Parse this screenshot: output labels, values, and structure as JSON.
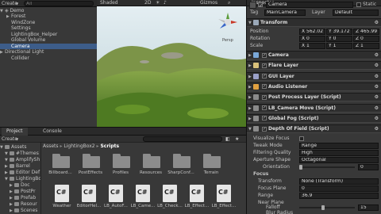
{
  "hierarchy": {
    "create_label": "Create",
    "search_placeholder": "All",
    "scene_name": "Demo",
    "items": [
      {
        "label": "Forest",
        "indent": 1,
        "selected": false,
        "expander": true
      },
      {
        "label": "WindZone",
        "indent": 1,
        "selected": false,
        "expander": false
      },
      {
        "label": "Settings",
        "indent": 1,
        "selected": false,
        "expander": false
      },
      {
        "label": "LightingBox_Helper",
        "indent": 1,
        "selected": false,
        "expander": false
      },
      {
        "label": "Global Volume",
        "indent": 1,
        "selected": false,
        "expander": false
      },
      {
        "label": "Camera",
        "indent": 1,
        "selected": true,
        "expander": false
      },
      {
        "label": "Directional Light",
        "indent": 0,
        "selected": false,
        "expander": true
      },
      {
        "label": "Collider",
        "indent": 1,
        "selected": false,
        "expander": false
      }
    ]
  },
  "scene": {
    "shading_label": "Shaded",
    "gizmos_label": "Gizmos",
    "persp_label": "Persp",
    "mode_2d": "2D",
    "colors": {
      "sky": "#cfe2ea",
      "hill": "#6f8a3a",
      "grass": "#5f8a2e"
    }
  },
  "inspector": {
    "tab_label": "Inspector",
    "object_name": "Camera",
    "static_label": "Static",
    "tag_label": "Tag",
    "tag_value": "MainCamera",
    "layer_label": "Layer",
    "layer_value": "Default",
    "transform": {
      "title": "Transform",
      "position_label": "Position",
      "rotation_label": "Rotation",
      "scale_label": "Scale",
      "pos": [
        "X 562.02",
        "Y 39.172",
        "Z 465.99"
      ],
      "rot": [
        "X 0",
        "Y 0",
        "Z 0"
      ],
      "scl": [
        "X 1",
        "Y 1",
        "Z 1"
      ]
    },
    "components": [
      {
        "label": "Camera",
        "icon": "camera-icon",
        "color": "#7aa8d8"
      },
      {
        "label": "Flare Layer",
        "icon": "flare-icon",
        "color": "#d8c07a"
      },
      {
        "label": "GUI Layer",
        "icon": "gui-icon",
        "color": "#9aa0c8"
      },
      {
        "label": "Audio Listener",
        "icon": "audio-icon",
        "color": "#e0a040"
      },
      {
        "label": "Post Process Layer (Script)",
        "icon": "script-icon",
        "color": "#8a8a8a"
      },
      {
        "label": "LB_Camera Move (Script)",
        "icon": "script-icon",
        "color": "#8a8a8a"
      },
      {
        "label": "Global Fog (Script)",
        "icon": "script-icon",
        "color": "#8a8a8a"
      },
      {
        "label": "Depth Of Field (Script)",
        "icon": "script-icon",
        "color": "#8a8a8a"
      }
    ],
    "dof": {
      "visualize_focus": "Visualize Focus",
      "tweak_mode": "Tweak Mode",
      "tweak_value": "Range",
      "filtering_quality": "Filtering Quality",
      "filtering_value": "High",
      "aperture_shape": "Aperture Shape",
      "aperture_value": "Octagonal",
      "orientation": "Orientation",
      "orientation_value": "0",
      "focus_header": "Focus",
      "transform_label": "Transform",
      "transform_value": "None (Transform)",
      "focus_plane": "Focus Plane",
      "focus_plane_value": "0",
      "range": "Range",
      "range_value": "36.9",
      "near_plane": "Near Plane",
      "falloff": "Falloff",
      "falloff_value": "15",
      "blur_radius": "Blur Radius"
    }
  },
  "project": {
    "tab_project": "Project",
    "tab_console": "Console",
    "create_label": "Create",
    "breadcrumb": [
      "Assets",
      "LightingBox2",
      "Scripts"
    ],
    "tree": [
      {
        "label": "Assets",
        "indent": 0,
        "expander": true
      },
      {
        "label": "#Themes",
        "indent": 1,
        "expander": true
      },
      {
        "label": "AmplifySh",
        "indent": 1,
        "expander": true
      },
      {
        "label": "Barrel",
        "indent": 1,
        "expander": false
      },
      {
        "label": "Editor Def",
        "indent": 1,
        "expander": false
      },
      {
        "label": "LightingBo",
        "indent": 1,
        "expander": true
      },
      {
        "label": "Doc",
        "indent": 2,
        "expander": false
      },
      {
        "label": "PostPr",
        "indent": 2,
        "expander": false
      },
      {
        "label": "Prefab",
        "indent": 2,
        "expander": false
      },
      {
        "label": "Resour",
        "indent": 2,
        "expander": false
      },
      {
        "label": "Scenes",
        "indent": 2,
        "expander": false
      }
    ],
    "folders": [
      "Billboard...",
      "PostEffects",
      "Profiles",
      "Resources",
      "SharpConf...",
      "Terrain"
    ],
    "files": [
      "Weather",
      "EditorHel...",
      "LB_AutoF...",
      "LB_Came...",
      "LB_Check...",
      "LB_Effect...",
      "LB_Effect..."
    ]
  }
}
